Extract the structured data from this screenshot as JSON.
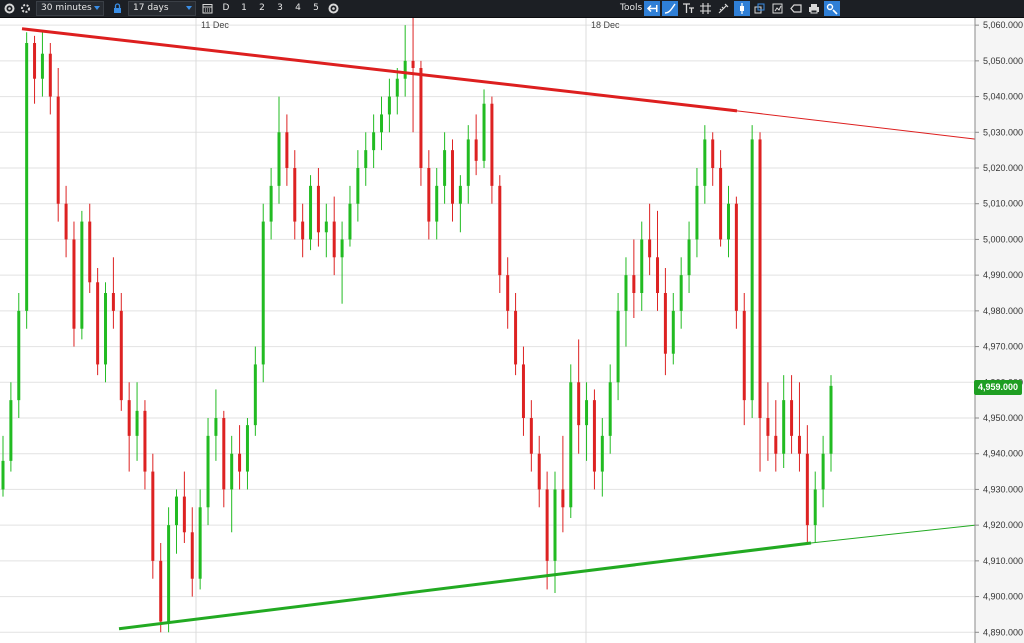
{
  "toolbar": {
    "interval_label": "30 minutes",
    "range_label": "17 days",
    "range_buttons": [
      "D",
      "1",
      "2",
      "3",
      "4",
      "5"
    ],
    "tools_label": "Tools",
    "icons": [
      "gear-icon",
      "lock-icon",
      "calendar-icon",
      "settings-icon",
      "arrow-left-icon",
      "trendline-icon",
      "text-tool-icon",
      "grid-icon",
      "pencil-icon",
      "crosshair-icon",
      "layers-icon",
      "chart-type-icon",
      "tag-icon",
      "print-icon",
      "customize-icon"
    ],
    "active_color": "#2f7fd6"
  },
  "chart_data": {
    "type": "candlestick",
    "x_labels": [
      "11 Dec",
      "18 Dec"
    ],
    "y_tick_labels": [
      "4,890.000",
      "4,900.000",
      "4,910.000",
      "4,920.000",
      "4,930.000",
      "4,940.000",
      "4,950.000",
      "4,960.000",
      "4,970.000",
      "4,980.000",
      "4,990.000",
      "5,000.000",
      "5,010.000",
      "5,020.000",
      "5,030.000",
      "5,040.000",
      "5,050.000",
      "5,060.000"
    ],
    "ylim": [
      4887,
      5062
    ],
    "last_price": 4959,
    "last_price_label": "4,959.000",
    "up_color": "#22bb22",
    "down_color": "#dd2222",
    "grid": true,
    "candles": [
      [
        4930,
        4945,
        4928,
        4938
      ],
      [
        4938,
        4960,
        4935,
        4955
      ],
      [
        4955,
        4985,
        4950,
        4980
      ],
      [
        4980,
        5058,
        4975,
        5055
      ],
      [
        5055,
        5057,
        5038,
        5045
      ],
      [
        5045,
        5058,
        5040,
        5052
      ],
      [
        5052,
        5055,
        5035,
        5040
      ],
      [
        5040,
        5048,
        5005,
        5010
      ],
      [
        5010,
        5015,
        4995,
        5000
      ],
      [
        5000,
        5005,
        4970,
        4975
      ],
      [
        4975,
        5008,
        4972,
        5005
      ],
      [
        5005,
        5010,
        4985,
        4988
      ],
      [
        4988,
        4992,
        4962,
        4965
      ],
      [
        4965,
        4988,
        4960,
        4985
      ],
      [
        4985,
        4995,
        4975,
        4980
      ],
      [
        4980,
        4985,
        4952,
        4955
      ],
      [
        4955,
        4960,
        4935,
        4945
      ],
      [
        4945,
        4960,
        4938,
        4952
      ],
      [
        4952,
        4955,
        4930,
        4935
      ],
      [
        4935,
        4940,
        4905,
        4910
      ],
      [
        4910,
        4915,
        4890,
        4893
      ],
      [
        4893,
        4925,
        4890,
        4920
      ],
      [
        4920,
        4930,
        4912,
        4928
      ],
      [
        4928,
        4935,
        4915,
        4918
      ],
      [
        4918,
        4925,
        4900,
        4905
      ],
      [
        4905,
        4930,
        4902,
        4925
      ],
      [
        4925,
        4950,
        4920,
        4945
      ],
      [
        4945,
        4958,
        4938,
        4950
      ],
      [
        4950,
        4952,
        4925,
        4930
      ],
      [
        4930,
        4945,
        4918,
        4940
      ],
      [
        4940,
        4948,
        4930,
        4935
      ],
      [
        4935,
        4950,
        4930,
        4948
      ],
      [
        4948,
        4970,
        4945,
        4965
      ],
      [
        4965,
        5010,
        4960,
        5005
      ],
      [
        5005,
        5020,
        5000,
        5015
      ],
      [
        5015,
        5040,
        5010,
        5030
      ],
      [
        5030,
        5035,
        5015,
        5020
      ],
      [
        5020,
        5025,
        5000,
        5005
      ],
      [
        5005,
        5010,
        4995,
        5000
      ],
      [
        5000,
        5018,
        4997,
        5015
      ],
      [
        5015,
        5020,
        4998,
        5002
      ],
      [
        5002,
        5010,
        4995,
        5005
      ],
      [
        5005,
        5012,
        4990,
        4995
      ],
      [
        4995,
        5005,
        4982,
        5000
      ],
      [
        5000,
        5015,
        4998,
        5010
      ],
      [
        5010,
        5025,
        5005,
        5020
      ],
      [
        5020,
        5030,
        5015,
        5025
      ],
      [
        5025,
        5035,
        5020,
        5030
      ],
      [
        5030,
        5040,
        5025,
        5035
      ],
      [
        5035,
        5045,
        5030,
        5040
      ],
      [
        5040,
        5048,
        5035,
        5045
      ],
      [
        5045,
        5060,
        5040,
        5050
      ],
      [
        5050,
        5070,
        5030,
        5048
      ],
      [
        5048,
        5050,
        5015,
        5020
      ],
      [
        5020,
        5025,
        5000,
        5005
      ],
      [
        5005,
        5020,
        5000,
        5015
      ],
      [
        5015,
        5030,
        5010,
        5025
      ],
      [
        5025,
        5028,
        5005,
        5010
      ],
      [
        5010,
        5018,
        5002,
        5015
      ],
      [
        5015,
        5032,
        5010,
        5028
      ],
      [
        5028,
        5035,
        5018,
        5022
      ],
      [
        5022,
        5042,
        5020,
        5038
      ],
      [
        5038,
        5040,
        5010,
        5015
      ],
      [
        5015,
        5018,
        4985,
        4990
      ],
      [
        4990,
        4995,
        4975,
        4980
      ],
      [
        4980,
        4985,
        4962,
        4965
      ],
      [
        4965,
        4970,
        4945,
        4950
      ],
      [
        4950,
        4955,
        4935,
        4940
      ],
      [
        4940,
        4945,
        4925,
        4930
      ],
      [
        4930,
        4935,
        4902,
        4910
      ],
      [
        4910,
        4935,
        4901,
        4930
      ],
      [
        4930,
        4945,
        4918,
        4925
      ],
      [
        4925,
        4965,
        4922,
        4960
      ],
      [
        4960,
        4972,
        4940,
        4948
      ],
      [
        4948,
        4960,
        4938,
        4955
      ],
      [
        4955,
        4958,
        4930,
        4935
      ],
      [
        4935,
        4950,
        4928,
        4945
      ],
      [
        4945,
        4965,
        4940,
        4960
      ],
      [
        4960,
        4985,
        4955,
        4980
      ],
      [
        4980,
        4995,
        4970,
        4990
      ],
      [
        4990,
        5000,
        4978,
        4985
      ],
      [
        4985,
        5005,
        4980,
        5000
      ],
      [
        5000,
        5010,
        4990,
        4995
      ],
      [
        4995,
        5008,
        4980,
        4985
      ],
      [
        4985,
        4992,
        4962,
        4968
      ],
      [
        4968,
        4985,
        4965,
        4980
      ],
      [
        4980,
        4995,
        4975,
        4990
      ],
      [
        4990,
        5005,
        4985,
        5000
      ],
      [
        5000,
        5020,
        4995,
        5015
      ],
      [
        5015,
        5032,
        5010,
        5028
      ],
      [
        5028,
        5030,
        5015,
        5020
      ],
      [
        5020,
        5025,
        4998,
        5000
      ],
      [
        5000,
        5015,
        4995,
        5010
      ],
      [
        5010,
        5012,
        4975,
        4980
      ],
      [
        4980,
        4985,
        4948,
        4955
      ],
      [
        4955,
        5032,
        4950,
        5028
      ],
      [
        5028,
        5030,
        4935,
        4950
      ],
      [
        4950,
        4960,
        4938,
        4945
      ],
      [
        4945,
        4955,
        4935,
        4940
      ],
      [
        4940,
        4962,
        4936,
        4955
      ],
      [
        4955,
        4962,
        4940,
        4945
      ],
      [
        4945,
        4960,
        4935,
        4940
      ],
      [
        4940,
        4948,
        4915,
        4920
      ],
      [
        4920,
        4935,
        4915,
        4930
      ],
      [
        4930,
        4945,
        4925,
        4940
      ],
      [
        4940,
        4962,
        4935,
        4959
      ]
    ],
    "trendlines": [
      {
        "name": "resistance",
        "color": "#dd1f1f",
        "points": [
          [
            0,
            5059
          ],
          [
            1,
            5036
          ]
        ],
        "extended_to": 5027
      },
      {
        "name": "support",
        "color": "#22aa22",
        "points": [
          [
            0,
            4891
          ],
          [
            1,
            4915
          ]
        ],
        "extended_to": 4921
      }
    ]
  }
}
